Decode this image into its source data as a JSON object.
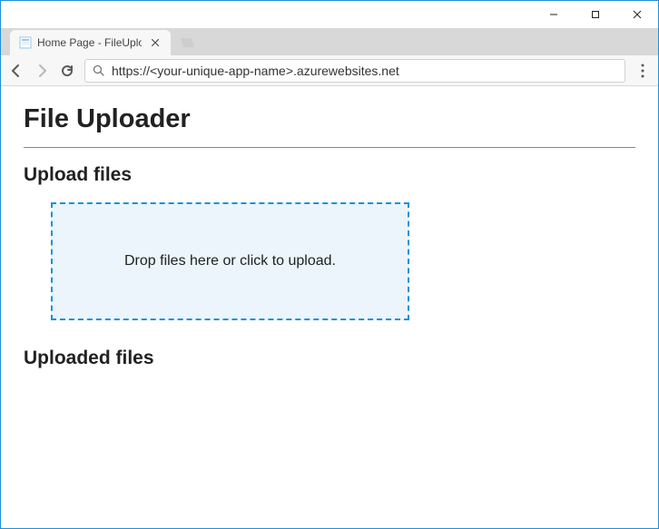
{
  "window": {
    "tab_title": "Home Page - FileUploade",
    "url": "https://<your-unique-app-name>.azurewebsites.net"
  },
  "page": {
    "heading": "File Uploader",
    "section_upload": "Upload files",
    "dropzone_text": "Drop files here or click to upload.",
    "section_uploaded": "Uploaded files"
  }
}
